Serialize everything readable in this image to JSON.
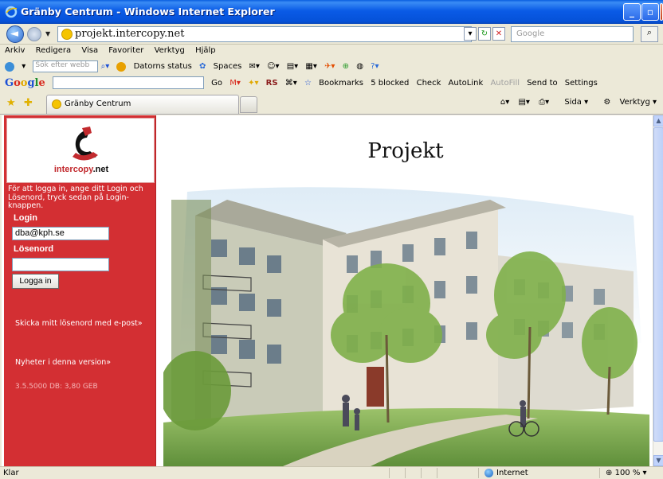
{
  "window": {
    "title": "Gränby Centrum - Windows Internet Explorer"
  },
  "address_bar": {
    "url": "projekt.intercopy.net",
    "search_placeholder": "Google"
  },
  "menu": [
    "Arkiv",
    "Redigera",
    "Visa",
    "Favoriter",
    "Verktyg",
    "Hjälp"
  ],
  "toolbar_live": {
    "search_placeholder": "Sök efter webb",
    "items": [
      "Datorns status",
      "Spaces"
    ]
  },
  "toolbar_google": {
    "go_label": "Go",
    "items": [
      "RS",
      "Bookmarks",
      "5 blocked",
      "Check",
      "AutoLink",
      "AutoFill",
      "Send to",
      "Settings"
    ]
  },
  "tab": {
    "label": "Gränby Centrum"
  },
  "command_bar": {
    "page_label": "Sida",
    "tools_label": "Verktyg"
  },
  "sidebar": {
    "logo_text": "intercopy",
    "logo_suffix": ".net",
    "login_info": "För att logga in, ange ditt Login och Lösenord, tryck sedan på Login-knappen.",
    "login_label": "Login",
    "login_value": "dba@kph.se",
    "password_label": "Lösenord",
    "login_button": "Logga in",
    "send_password_link": "Skicka mitt lösenord med e-post»",
    "news_link": "Nyheter i denna version»",
    "version": "3.5.5000 DB: 3,80 GEB"
  },
  "main": {
    "title": "Projekt"
  },
  "status": {
    "text": "Klar",
    "zone": "Internet",
    "zoom": "100 %"
  },
  "colors": {
    "sidebar_bg": "#d32f33",
    "titlebar": "#0a5be6"
  }
}
